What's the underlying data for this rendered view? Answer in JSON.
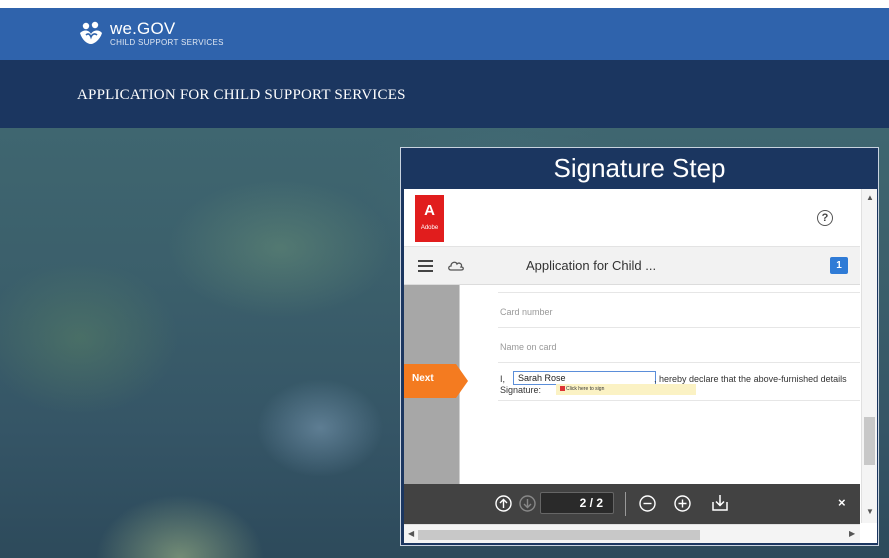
{
  "header": {
    "brand": "we.GOV",
    "brand_sub": "CHILD SUPPORT SERVICES",
    "app_title": "APPLICATION FOR CHILD SUPPORT SERVICES"
  },
  "panel": {
    "title": "Signature Step"
  },
  "viewer": {
    "adobe_label": "Adobe",
    "help_glyph": "?",
    "doc_title": "Application for Child ...",
    "page_badge": "1",
    "page_indicator": "2 / 2",
    "close_glyph": "×"
  },
  "form": {
    "card_number_label": "Card number",
    "name_on_card_label": "Name on card",
    "declaration_prefix": "I,",
    "signer_name": "Sarah Rose",
    "declaration_suffix": ",  hereby declare that the above-furnished details",
    "signature_label": "Signature:",
    "signature_placeholder": "Click here to sign",
    "next_label": "Next"
  },
  "colors": {
    "header_blue": "#2f63ac",
    "title_navy": "#1b3660",
    "adobe_red": "#e11d1d",
    "next_orange": "#f47b20",
    "sign_field": "#fbf2c4"
  }
}
